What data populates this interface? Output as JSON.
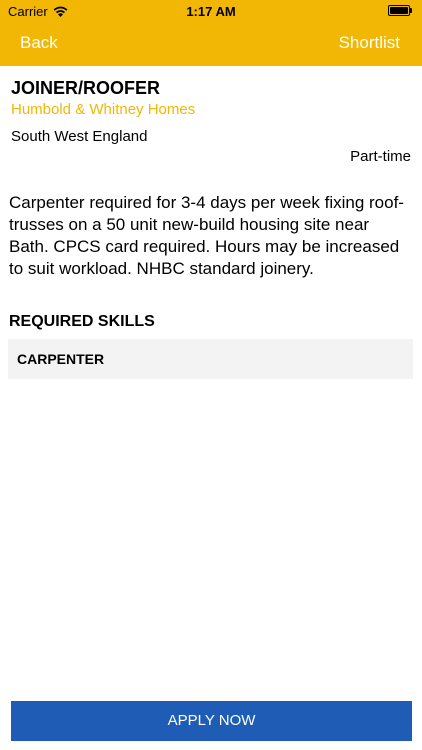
{
  "status_bar": {
    "carrier": "Carrier",
    "time": "1:17 AM"
  },
  "nav": {
    "back_label": "Back",
    "shortlist_label": "Shortlist"
  },
  "job": {
    "title": "JOINER/ROOFER",
    "company": "Humbold & Whitney Homes",
    "location": "South West England",
    "type": "Part-time",
    "description": "Carpenter required for 3-4 days per week fixing roof-trusses on a 50 unit new-build housing site near Bath. CPCS card required. Hours may be increased to suit workload. NHBC standard joinery."
  },
  "skills": {
    "heading": "REQUIRED SKILLS",
    "items": [
      "CARPENTER"
    ]
  },
  "apply": {
    "label": "APPLY NOW"
  },
  "colors": {
    "accent": "#f2b705",
    "button": "#1f5cb5",
    "skill_bg": "#f3f3f3"
  },
  "icons": [
    "wifi-icon",
    "battery-icon"
  ]
}
